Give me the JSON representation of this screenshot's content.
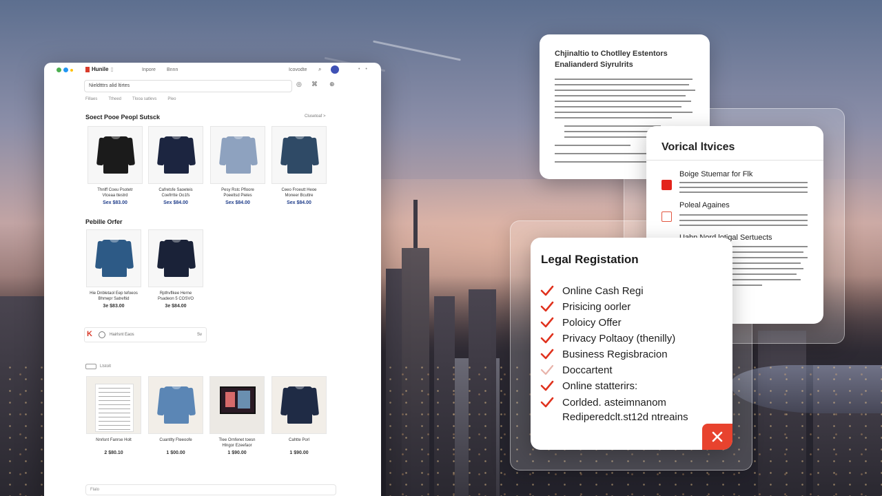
{
  "colors": {
    "accent": "#e3241b",
    "price_blue": "#1f3d8a",
    "panel_bg": "#ffffff"
  },
  "browser": {
    "logo": "Hunile",
    "nav": [
      "Inpore",
      "Bnnn"
    ],
    "account": "Icovodte",
    "search_icon": "search-icon",
    "url": "Nieldtttrs alid ltirtes",
    "filters": [
      "Fillaes",
      "Ttheed",
      "Tlooa satlevs",
      "Pleo"
    ],
    "section1": {
      "title": "Soect Pooe Peopl Sutsck",
      "see_all": "Clusetoaf >"
    },
    "products1": [
      {
        "name": "Thnlff Coeu Psotetr\nVtceaa ttestrd",
        "price": "Sex $83.00",
        "shirt_color": "#1b1b1b"
      },
      {
        "name": "Cafretsfe Saoeteis\nCoefrrtte Oo1fs",
        "price": "Sex $84.00",
        "shirt_color": "#1c2540"
      },
      {
        "name": "Pesy Rstc Pfloore\nPoeeltsd Pieles",
        "price": "Sex $84.00",
        "shirt_color": "#8ea2bf"
      },
      {
        "name": "Ceeo Froeutt Heoe\nMoneer Bcuttre",
        "price": "Sex $84.00",
        "shirt_color": "#2f4a66"
      }
    ],
    "section2": {
      "title": "Pebille Orfer"
    },
    "products2": [
      {
        "name": "Hie Dnbletaol Eep tefoeos\nBhmepr Satreftid",
        "price": "3e $83.00",
        "shirt_color": "#2d5a86"
      },
      {
        "name": "Rpthvflkee Herne\nPsadeon 5 COSVO",
        "price": "3e $84.00",
        "shirt_color": "#1a2238"
      }
    ],
    "banner": {
      "text": "Hairlsnt Eaos",
      "right": "Sv"
    },
    "recent": {
      "label": "Ltstolt"
    },
    "products3": [
      {
        "name": "Nnrlsnt Fanrse Holt",
        "price": "2 $80.10",
        "kind": "doc"
      },
      {
        "name": "Cuantlty Fteeoofe",
        "price": "1 $00.00",
        "shirt_color": "#5b86b5"
      },
      {
        "name": "Tlee Ornfenet toesn\nHlngor Ezeefaor",
        "price": "1 $90.00",
        "kind": "tv"
      },
      {
        "name": "Cahtte Porl",
        "price": "1 $90.00",
        "shirt_color": "#1f2b45"
      }
    ],
    "bottom": "Flalo"
  },
  "doc_panel": {
    "title": "Chjinaltio to Chotlley Estentors Enalianderd Siyrulrits"
  },
  "verification_panel": {
    "title": "Vorical ltvices",
    "items": [
      {
        "label": "Boige Stuemar for Flk",
        "checked": true
      },
      {
        "label": "Poleal Againes",
        "checked": false
      },
      {
        "label": "Uahn Nord lotigal Sertuects",
        "checked": false
      }
    ]
  },
  "legal_panel": {
    "title": "Legal Registation",
    "items": [
      {
        "label": "Online Cash Regi",
        "checked": true
      },
      {
        "label": "Prisicing oorler",
        "checked": true
      },
      {
        "label": "Poloicy Offer",
        "checked": true
      },
      {
        "label": "Privacy Poltaoy (thenilly)",
        "checked": true
      },
      {
        "label": "Business Regisbracion",
        "checked": true
      },
      {
        "label": "Doccartent",
        "checked": true,
        "faded": true
      },
      {
        "label": "Online statterirs:",
        "checked": true
      },
      {
        "label": "Corlded. asteimnanom",
        "checked": true
      },
      {
        "label": "Rediperedclt.st12d ntreains",
        "checked": false
      }
    ],
    "close_icon": "close-icon"
  }
}
